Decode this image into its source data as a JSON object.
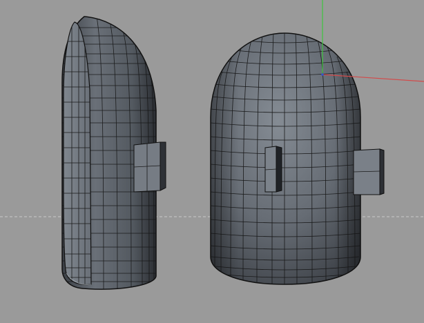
{
  "viewport": {
    "background": "#9a9a9a",
    "icons": {
      "world_axis_y": "green-axis-icon",
      "world_axis_x": "red-axis-icon",
      "ground_line": "dashed-ground-line"
    },
    "colors": {
      "axis_y": "#3ec43e",
      "axis_x": "#d34a4a",
      "ground": "#c9c9c9",
      "mesh_light": "#727880",
      "mesh_dark": "#2a2d31",
      "wire": "#151515"
    }
  },
  "objects": [
    {
      "name": "half-capsule-mesh",
      "visible": true
    },
    {
      "name": "capsule-mesh",
      "visible": true
    }
  ]
}
